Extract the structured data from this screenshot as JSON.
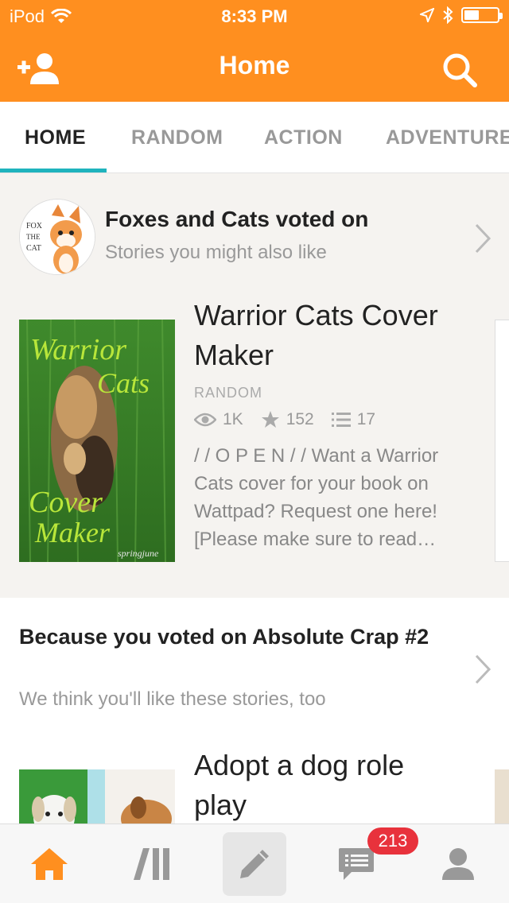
{
  "status_bar": {
    "carrier": "iPod",
    "time": "8:33 PM",
    "battery_level": 0.45
  },
  "header": {
    "title": "Home",
    "left_icon": "add-user-icon",
    "right_icon": "search-icon"
  },
  "tabs": [
    {
      "label": "HOME",
      "active": true
    },
    {
      "label": "RANDOM",
      "active": false
    },
    {
      "label": "ACTION",
      "active": false
    },
    {
      "label": "ADVENTURE",
      "active": false
    }
  ],
  "section1": {
    "avatar_text": "FOX THE CAT",
    "title": "Foxes and Cats voted on",
    "subtitle": "Stories you might also like",
    "story": {
      "title_line1": "Warrior Cats Cover",
      "title_line2": "Maker",
      "category": "RANDOM",
      "reads": "1K",
      "votes": "152",
      "parts": "17",
      "description": "/ / O P E N / / Want a Warrior Cats cover for your book on Wattpad? Request one here! [Please make sure to read…",
      "cover_line1": "Warrior",
      "cover_line2": "Cats",
      "cover_line3": "Cover",
      "cover_line4": "Maker",
      "cover_credit": "springjune"
    }
  },
  "section2": {
    "title": "Because you voted on Absolute Crap #2",
    "subtitle": "We think you'll like these stories, too",
    "story": {
      "title_line1": "Adopt a dog role",
      "title_line2": "play"
    }
  },
  "bottom_nav": {
    "items": [
      "home-icon",
      "library-icon",
      "write-icon",
      "messages-icon",
      "profile-icon"
    ],
    "message_badge": "213"
  },
  "colors": {
    "brand": "#ff8f1f",
    "accent": "#1fb3bd",
    "badge": "#e8323c"
  }
}
